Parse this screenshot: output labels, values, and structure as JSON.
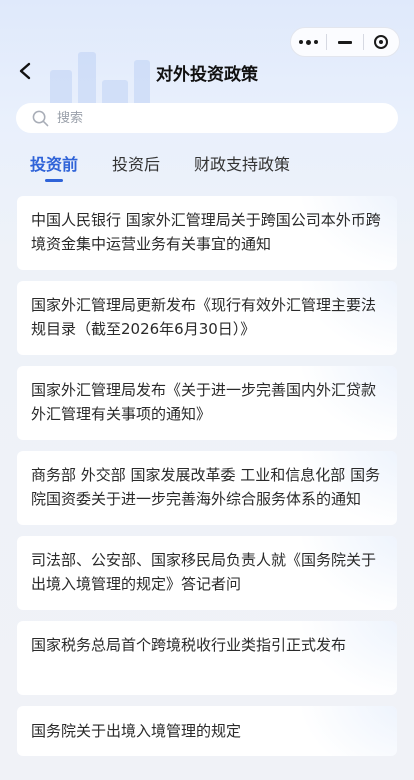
{
  "capsule": {
    "more_icon": "more-dots-icon",
    "minimize_icon": "minimize-icon",
    "close_icon": "target-close-icon"
  },
  "header": {
    "title": "对外投资政策",
    "back_icon": "chevron-left-icon"
  },
  "search": {
    "placeholder": "搜索",
    "value": "",
    "icon": "search-icon"
  },
  "tabs": [
    {
      "label": "投资前",
      "active": true
    },
    {
      "label": "投资后",
      "active": false
    },
    {
      "label": "财政支持政策",
      "active": false
    }
  ],
  "accent_color": "#2f63d8",
  "articles": [
    {
      "title": "中国人民银行 国家外汇管理局关于跨国公司本外币跨境资金集中运营业务有关事宜的通知"
    },
    {
      "title": "国家外汇管理局更新发布《现行有效外汇管理主要法规目录（截至2026年6月30日）》"
    },
    {
      "title": "国家外汇管理局发布《关于进一步完善国内外汇贷款外汇管理有关事项的通知》"
    },
    {
      "title": "商务部 外交部 国家发展改革委 工业和信息化部 国务院国资委关于进一步完善海外综合服务体系的通知"
    },
    {
      "title": "司法部、公安部、国家移民局负责人就《国务院关于出境入境管理的规定》答记者问"
    },
    {
      "title": "国家税务总局首个跨境税收行业类指引正式发布"
    },
    {
      "title": "国务院关于出境入境管理的规定"
    }
  ]
}
